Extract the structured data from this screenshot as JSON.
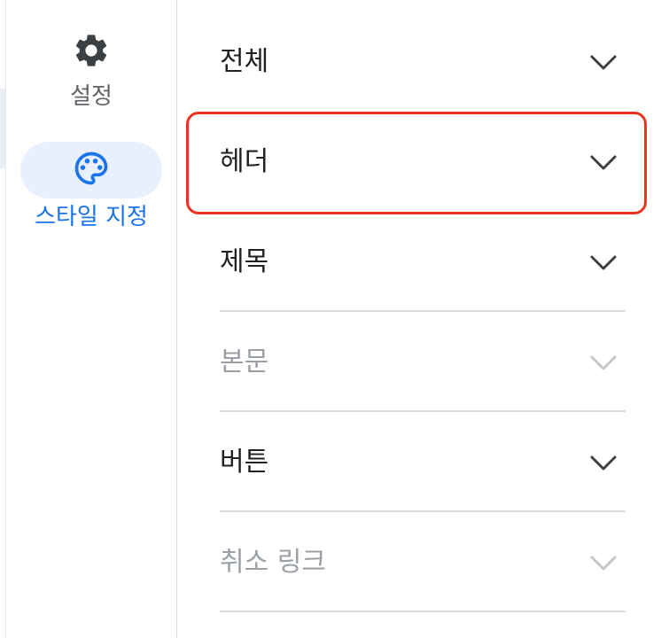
{
  "nav_rail": {
    "settings": {
      "label": "설정",
      "icon": "gear-icon"
    },
    "style": {
      "label": "스타일 지정",
      "icon": "palette-icon",
      "selected": true,
      "accent": "#1a73e8"
    }
  },
  "sections": [
    {
      "label": "전체",
      "enabled": true
    },
    {
      "label": "헤더",
      "enabled": true,
      "highlighted": true
    },
    {
      "label": "제목",
      "enabled": true
    },
    {
      "label": "본문",
      "enabled": false
    },
    {
      "label": "버튼",
      "enabled": true
    },
    {
      "label": "취소 링크",
      "enabled": false
    }
  ],
  "colors": {
    "highlight": "#ea3323",
    "selected_pill": "#e8f0fe",
    "text": "#202124",
    "disabled_text": "#9aa0a6",
    "divider": "#dadce0"
  }
}
